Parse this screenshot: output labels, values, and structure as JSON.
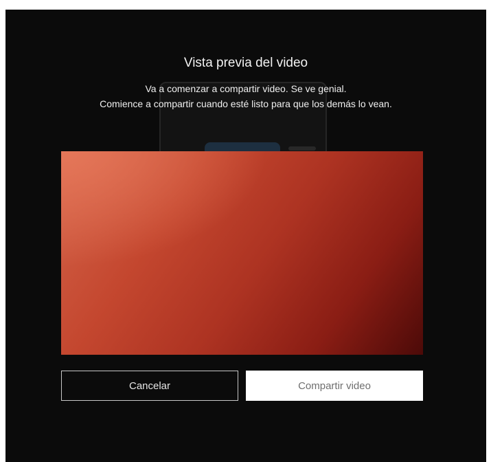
{
  "dialog": {
    "title": "Vista previa del video",
    "message_line1": "Va a comenzar a compartir video. Se ve genial.",
    "message_line2": "Comience a compartir cuando esté listo para que los demás lo vean."
  },
  "buttons": {
    "cancel_label": "Cancelar",
    "share_label": "Compartir video"
  },
  "colors": {
    "background": "#0b0b0b",
    "preview_light": "#d4644a",
    "preview_dark": "#4c0a08",
    "primary_button_bg": "#ffffff"
  }
}
